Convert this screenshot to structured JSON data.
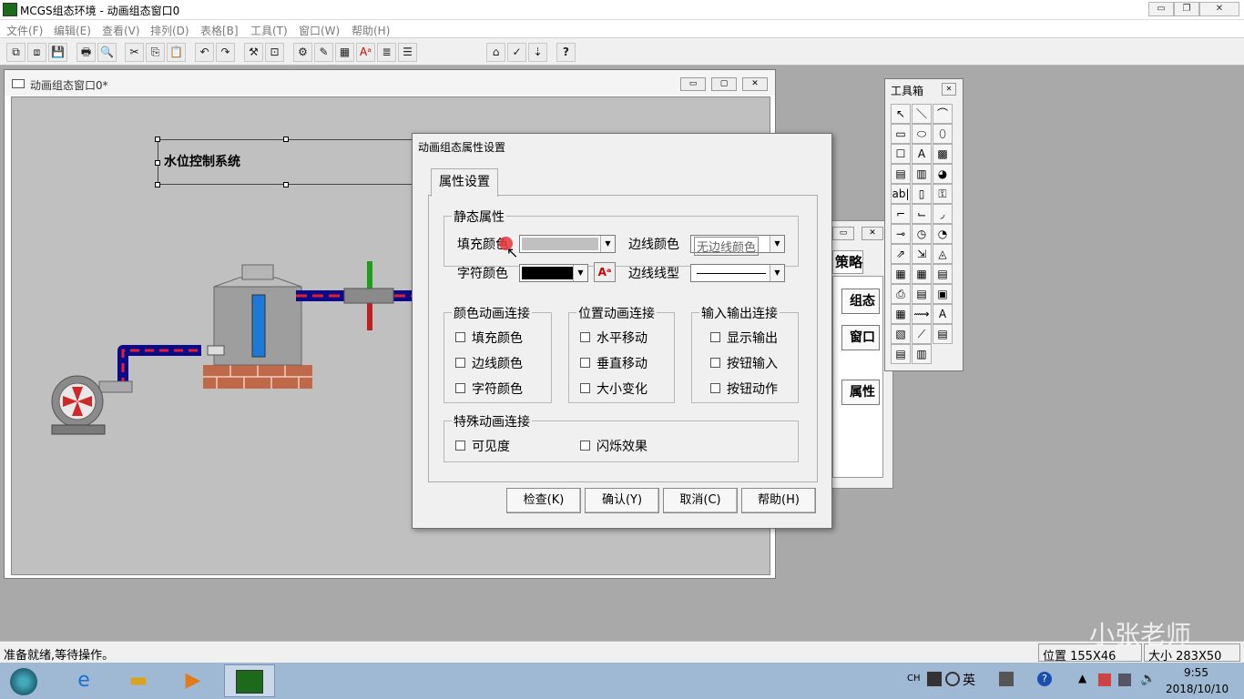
{
  "app": {
    "title": "MCGS组态环境 - 动画组态窗口0",
    "min": "▭",
    "max": "❐",
    "close": "✕"
  },
  "menu": [
    "文件(F)",
    "编辑(E)",
    "查看(V)",
    "排列(D)",
    "表格[B]",
    "工具(T)",
    "窗口(W)",
    "帮助(H)"
  ],
  "toolbar": [
    "⧉",
    "⧈",
    "💾",
    "🖶",
    "🔍",
    "✂",
    "⎘",
    "📋",
    "↶",
    "↷",
    "⚒",
    "⊡",
    "⚙",
    "✎",
    "▦",
    "Aᵃ",
    "≣",
    "☰",
    "⌂",
    "✓",
    "⇣",
    "?"
  ],
  "child": {
    "title": "动画组态窗口0*",
    "min": "▭",
    "max": "▢",
    "close": "✕"
  },
  "canvas": {
    "label": "水位控制系统"
  },
  "bg_window": {
    "buttons": [
      "组态",
      "窗口",
      "属性"
    ],
    "tab": "策略",
    "min": "▭",
    "close": "✕"
  },
  "dialog": {
    "title": "动画组态属性设置",
    "tab": "属性设置",
    "static_group": "静态属性",
    "fill_color_label": "填充颜色",
    "font_color_label": "字符颜色",
    "border_color_label": "边线颜色",
    "border_color_value": "无边线颜色",
    "line_type_label": "边线线型",
    "color_anim": {
      "title": "颜色动画连接",
      "items": [
        "填充颜色",
        "边线颜色",
        "字符颜色"
      ]
    },
    "pos_anim": {
      "title": "位置动画连接",
      "items": [
        "水平移动",
        "垂直移动",
        "大小变化"
      ]
    },
    "io_anim": {
      "title": "输入输出连接",
      "items": [
        "显示输出",
        "按钮输入",
        "按钮动作"
      ]
    },
    "special": {
      "title": "特殊动画连接",
      "items": [
        "可见度",
        "闪烁效果"
      ]
    },
    "buttons": [
      "检查(K)",
      "确认(Y)",
      "取消(C)",
      "帮助(H)"
    ],
    "colors": {
      "fill": "#c0c0c0",
      "font": "#000000"
    }
  },
  "toolbox": {
    "title": "工具箱",
    "close": "✕",
    "tools": [
      "↖",
      "＼",
      "⌒",
      "▭",
      "⬭",
      "⬯",
      "☐",
      "A",
      "▩",
      "▤",
      "▥",
      "◕",
      "ab|",
      "▯",
      "⚿",
      "⌐",
      "⌙",
      "◞",
      "⊸",
      "◷",
      "◔",
      "⇗",
      "⇲",
      "◬",
      "▦",
      "▦",
      "▤",
      "⎙",
      "▤",
      "▣",
      "▦",
      "⟿",
      "A",
      "▧",
      "⟋",
      "▤",
      "▤",
      "▥"
    ]
  },
  "status": {
    "left": "准备就绪,等待操作。",
    "pos": "位置 155X46",
    "size": "大小 283X50"
  },
  "taskbar": {
    "lang": "CH",
    "ime": "英",
    "time": "9:55",
    "date": "2018/10/10",
    "watermark": "小张老师"
  }
}
